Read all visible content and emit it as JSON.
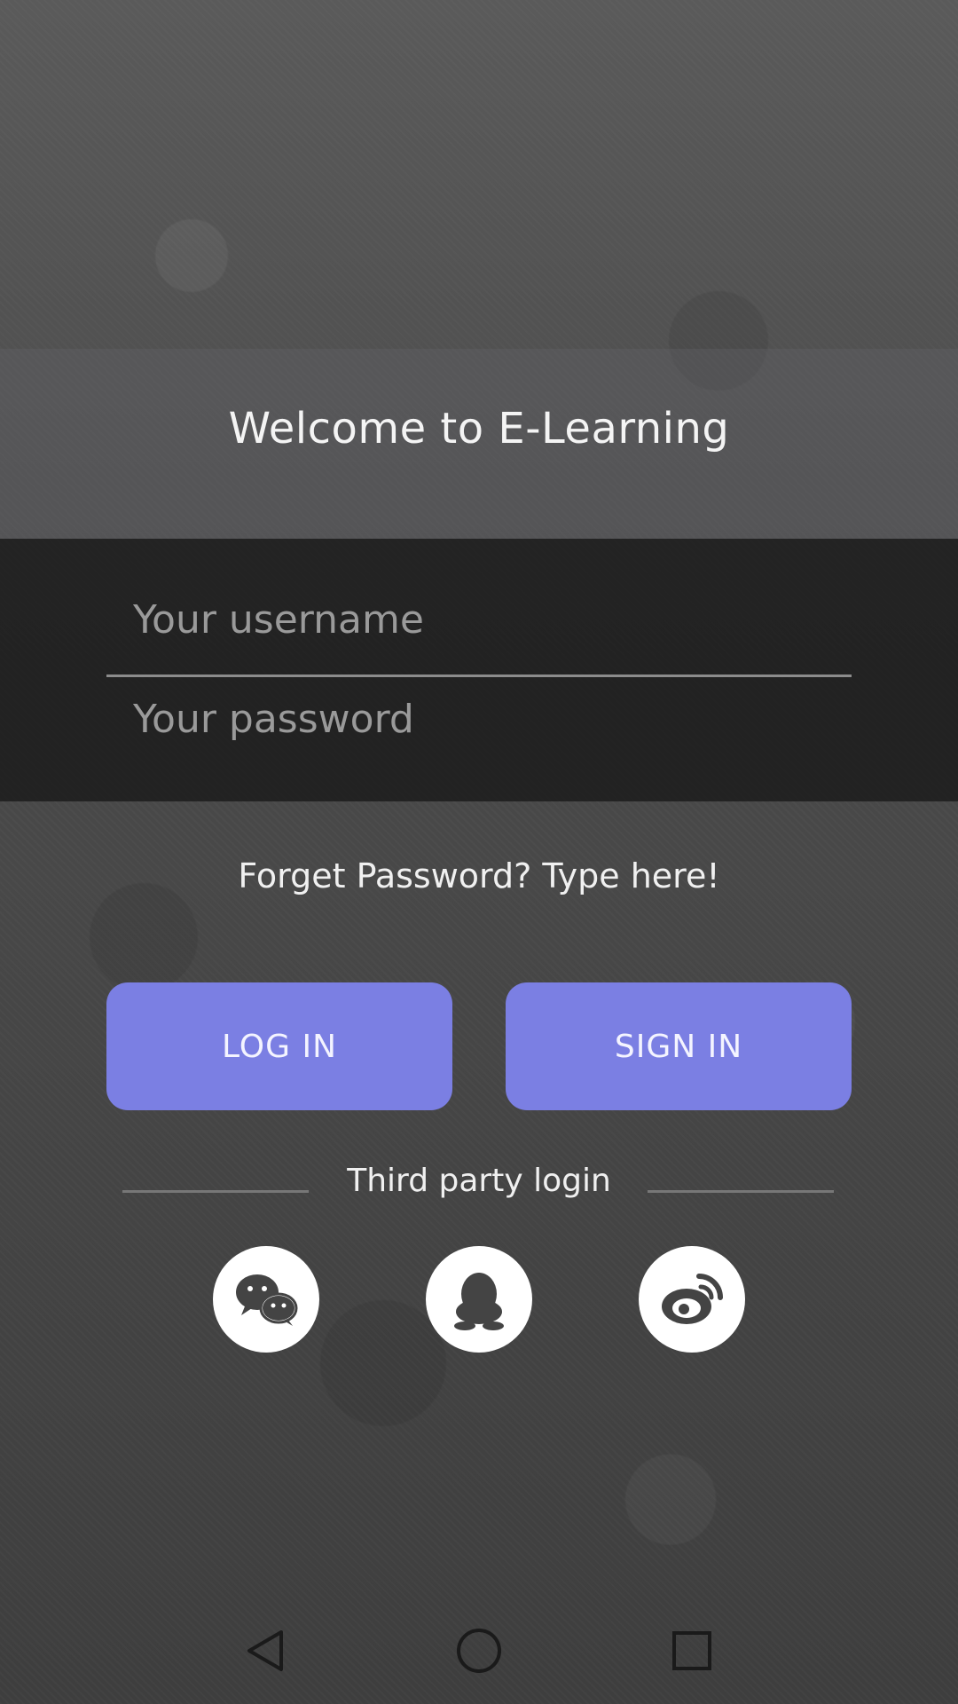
{
  "header": {
    "title": "Welcome to E-Learning"
  },
  "form": {
    "username_placeholder": "Your username",
    "password_placeholder": "Your password"
  },
  "forget_password": {
    "text": "Forget Password?  Type here!"
  },
  "buttons": {
    "login_label": "LOG IN",
    "signin_label": "SIGN IN"
  },
  "third_party": {
    "label": "Third party login",
    "providers": [
      {
        "icon": "wechat-icon"
      },
      {
        "icon": "qq-icon"
      },
      {
        "icon": "weibo-icon"
      }
    ]
  },
  "colors": {
    "button": "#7b7fe3",
    "form_band": "#141414",
    "background": "#4a4a4a"
  },
  "navbar": {
    "icons": [
      "back-icon",
      "home-icon",
      "recent-apps-icon"
    ]
  }
}
